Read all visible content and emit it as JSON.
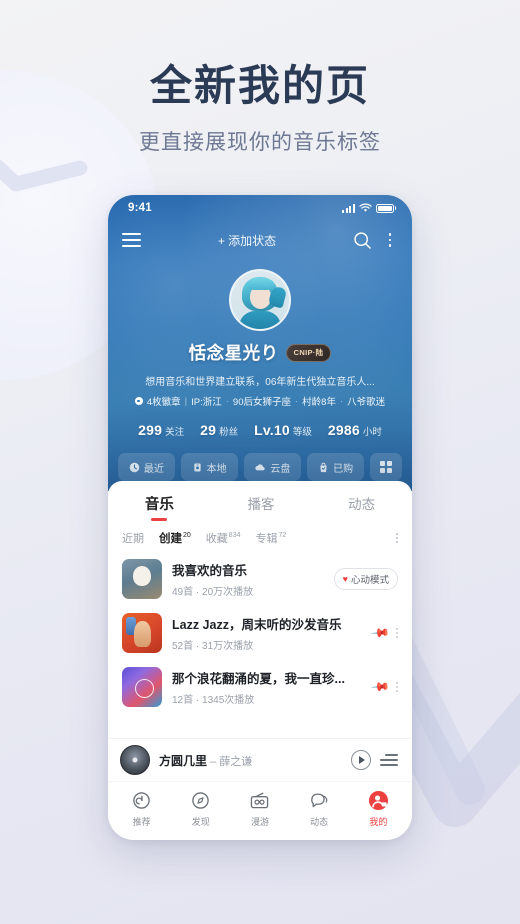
{
  "promo": {
    "headline": "全新我的页",
    "subhead": "更直接展现你的音乐标签"
  },
  "colors": {
    "accent_red": "#ec4141",
    "header_blue": "#2e76b6",
    "page_bg": "#ecedf4",
    "title_text": "#2b3a55"
  },
  "phone": {
    "statusbar": {
      "time": "9:41",
      "signal_icon": "cellular-bars-icon",
      "wifi_icon": "wifi-icon",
      "battery_icon": "battery-full-icon"
    },
    "navbar": {
      "menu_icon": "hamburger-menu-icon",
      "add_status_label": "+ 添加状态",
      "search_icon": "search-icon",
      "more_icon": "more-vertical-icon"
    },
    "profile": {
      "avatar_alt": "user-avatar",
      "username": "恬念星光り",
      "vip_badge": "CNIP·陆",
      "bio": "想用音乐和世界建立联系，06年新生代独立音乐人...",
      "tags": {
        "badge_icon": "medal-icon",
        "badge_count": "4枚徽章",
        "divider": "|",
        "items": [
          "IP:浙江",
          "90后女狮子座",
          "村龄8年",
          "八爷歌迷"
        ],
        "separator": "·"
      },
      "stats": [
        {
          "num": "299",
          "label": "关注"
        },
        {
          "num": "29",
          "label": "粉丝"
        },
        {
          "num": "Lv.10",
          "label": "等级"
        },
        {
          "num": "2986",
          "label": "小时"
        }
      ],
      "chips": [
        {
          "icon": "clock-icon",
          "label": "最近"
        },
        {
          "icon": "device-icon",
          "label": "本地"
        },
        {
          "icon": "cloud-icon",
          "label": "云盘"
        },
        {
          "icon": "bag-icon",
          "label": "已购"
        }
      ],
      "chip_grid_icon": "grid-icon"
    },
    "tabs": [
      {
        "label": "音乐",
        "active": true
      },
      {
        "label": "播客",
        "active": false
      },
      {
        "label": "动态",
        "active": false
      }
    ],
    "filters": [
      {
        "label": "近期",
        "count": "",
        "active": false
      },
      {
        "label": "创建",
        "count": "20",
        "active": true
      },
      {
        "label": "收藏",
        "count": "834",
        "active": false
      },
      {
        "label": "专辑",
        "count": "72",
        "active": false
      }
    ],
    "filters_more_icon": "more-vertical-icon",
    "playlists": [
      {
        "title": "我喜欢的音乐",
        "sub": "49首 · 20万次播放",
        "badge": "心动模式",
        "badge_icon": "heart-icon",
        "pinned": false
      },
      {
        "title": "Lazz Jazz，周末听的沙发音乐",
        "sub": "52首 · 31万次播放",
        "badge": "",
        "pinned": true
      },
      {
        "title": "那个浪花翻涌的夏，我一直珍...",
        "sub": "12首 · 1345次播放",
        "badge": "",
        "pinned": true
      }
    ],
    "miniplayer": {
      "cover_alt": "now-playing-cover",
      "song": "方圆几里",
      "dash": " – ",
      "artist": "薛之谦",
      "play_icon": "play-icon",
      "queue_icon": "playlist-queue-icon"
    },
    "bottomnav": [
      {
        "label": "推荐",
        "icon": "recommend-icon",
        "active": false
      },
      {
        "label": "发现",
        "icon": "compass-icon",
        "active": false
      },
      {
        "label": "漫游",
        "icon": "radio-icon",
        "active": false
      },
      {
        "label": "动态",
        "icon": "chat-icon",
        "active": false
      },
      {
        "label": "我的",
        "icon": "profile-icon",
        "active": true
      }
    ]
  }
}
